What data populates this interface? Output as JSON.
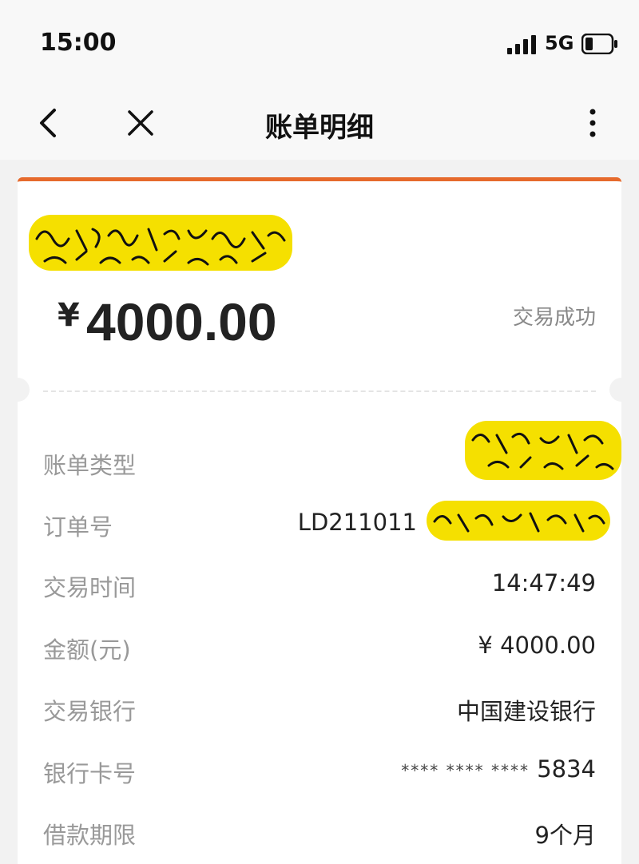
{
  "status_bar": {
    "time": "15:00",
    "network": "5G"
  },
  "nav": {
    "title": "账单明细",
    "back_icon": "chevron-left-icon",
    "close_icon": "close-icon",
    "more_icon": "more-vertical-icon"
  },
  "summary": {
    "currency_symbol": "¥",
    "amount": "4000.00",
    "status": "交易成功"
  },
  "details": [
    {
      "label": "账单类型",
      "value": ""
    },
    {
      "label": "订单号",
      "value": "LD211011"
    },
    {
      "label": "交易时间",
      "value": "14:47:49"
    },
    {
      "label": "金额(元)",
      "value": "¥ 4000.00"
    },
    {
      "label": "交易银行",
      "value": "中国建设银行"
    },
    {
      "label": "银行卡号",
      "value_mask": "**** **** ****",
      "value_last4": "5834"
    },
    {
      "label": "借款期限",
      "value": "9个月"
    }
  ],
  "colors": {
    "accent": "#e66a2c",
    "highlight": "#f5e000",
    "background": "#f2f2f2"
  }
}
